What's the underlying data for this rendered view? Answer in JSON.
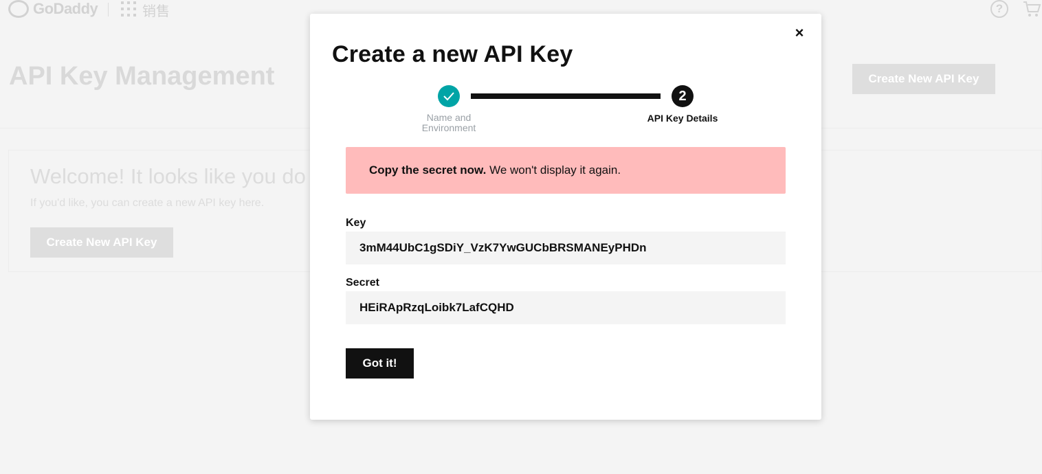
{
  "header": {
    "logo_text": "GoDaddy",
    "apps_label": "销售",
    "help_icon": "question-circle-icon",
    "cart_icon": "cart-icon"
  },
  "page": {
    "title": "API Key Management",
    "create_button": "Create New API Key"
  },
  "welcome": {
    "heading": "Welcome! It looks like you do",
    "subtext": "If you'd like, you can create a new API key here.",
    "create_button": "Create New API Key"
  },
  "modal": {
    "title": "Create a new API Key",
    "close_icon": "close-icon",
    "steps": [
      {
        "label": "Name and Environment",
        "state": "complete",
        "icon": "check-icon"
      },
      {
        "label": "API Key Details",
        "number": "2",
        "state": "active"
      }
    ],
    "alert": {
      "bold": "Copy the secret now.",
      "text": " We won't display it again."
    },
    "key_label": "Key",
    "key_value": "3mM44UbC1gSDiY_VzK7YwGUCbBRSMANEyPHDn",
    "secret_label": "Secret",
    "secret_value": "HEiRApRzqLoibk7LafCQHD",
    "confirm_button": "Got it!"
  },
  "colors": {
    "accent_teal": "#00a4a6",
    "alert_bg": "#ffbbbb",
    "primary_button": "#111111"
  }
}
